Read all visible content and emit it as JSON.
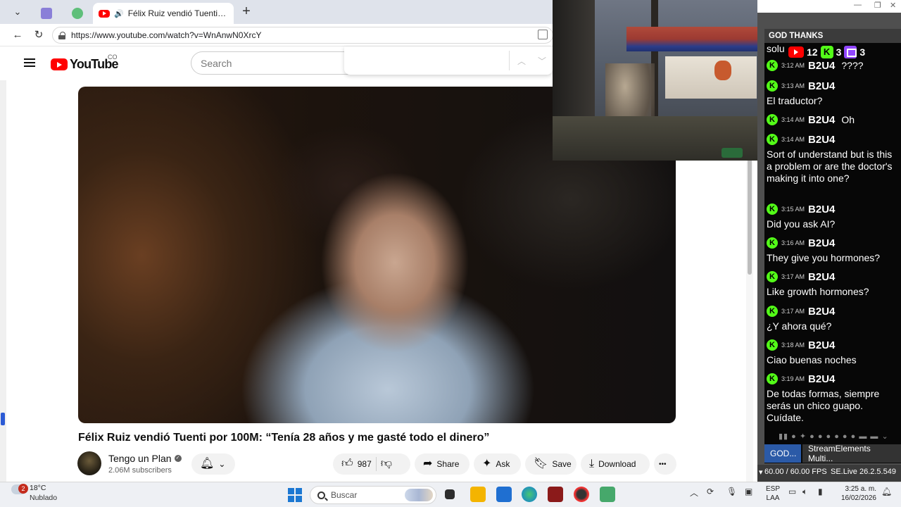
{
  "browser": {
    "tabs": [
      {
        "label": ""
      },
      {
        "label": ""
      },
      {
        "label": "Félix Ruiz vendió Tuenti por 1"
      }
    ],
    "url": "https://www.youtube.com/watch?v=WnAnwN0XrcY"
  },
  "youtube": {
    "logo_text": "YouTube",
    "country_code": "CO",
    "search_placeholder": "Search",
    "video_title": "Félix Ruiz vendió Tuenti por 100M: “Tenía 28 años y me gasté todo el dinero”",
    "channel_name": "Tengo un Plan",
    "subscribers": "2.06M subscribers",
    "likes": "987",
    "share_label": "Share",
    "ask_label": "Ask",
    "save_label": "Save",
    "download_label": "Download",
    "more_label": "•••"
  },
  "chat": {
    "header": "GOD THANKS",
    "partial_text": "solu",
    "counters": {
      "youtube": "12",
      "kick": "3",
      "twitch": "3"
    },
    "messages": [
      {
        "time": "3:12 AM",
        "user": "B2U4",
        "inline": "????",
        "text": ""
      },
      {
        "time": "3:13 AM",
        "user": "B2U4",
        "inline": "",
        "text": "El traductor?"
      },
      {
        "time": "3:14 AM",
        "user": "B2U4",
        "inline": "Oh",
        "text": ""
      },
      {
        "time": "3:14 AM",
        "user": "B2U4",
        "inline": "",
        "text": "Sort of understand but is this a problem or are the doctor's making it into one?"
      },
      {
        "time": "3:15 AM",
        "user": "B2U4",
        "inline": "",
        "text": "Did you ask AI?"
      },
      {
        "time": "3:16 AM",
        "user": "B2U4",
        "inline": "",
        "text": "They give you hormones?"
      },
      {
        "time": "3:17 AM",
        "user": "B2U4",
        "inline": "",
        "text": "Like growth hormones?"
      },
      {
        "time": "3:17 AM",
        "user": "B2U4",
        "inline": "",
        "text": "¿Y ahora qué?"
      },
      {
        "time": "3:18 AM",
        "user": "B2U4",
        "inline": "",
        "text": "Ciao buenas noches"
      },
      {
        "time": "3:19 AM",
        "user": "B2U4",
        "inline": "",
        "text": "De todas formas, siempre serás un chico guapo. Cuídate."
      }
    ],
    "tab_a": "GOD...",
    "tab_b": "StreamElements Multi...",
    "fps": "60.00 / 60.00 FPS",
    "version": "SE.Live 26.2.5.549"
  },
  "taskbar": {
    "weather_badge": "2",
    "temperature": "18°C",
    "weather_desc": "Nublado",
    "search_placeholder": "Buscar",
    "lang_top": "ESP",
    "lang_bottom": "LAA",
    "time": "3:25 a. m.",
    "date": "16/02/2026"
  },
  "colors": {
    "youtube_red": "#ff0000",
    "kick_green": "#53fc18",
    "twitch_purple": "#9146ff",
    "chat_bg": "#070707",
    "tab_active_blue": "#2b5aa7"
  }
}
